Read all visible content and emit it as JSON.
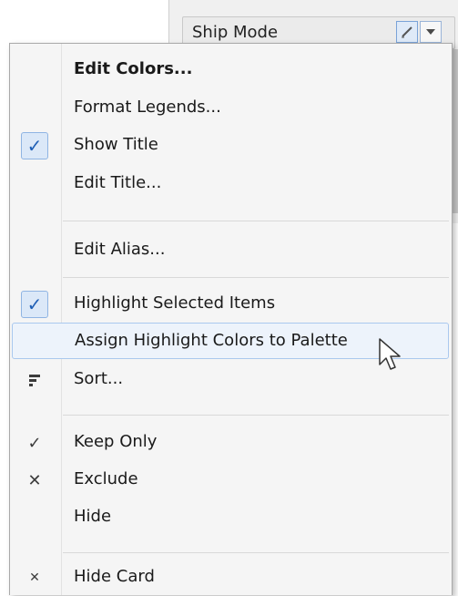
{
  "legend_card": {
    "title": "Ship Mode"
  },
  "menu": {
    "items": [
      {
        "label": "Edit Colors..."
      },
      {
        "label": "Format Legends..."
      },
      {
        "label": "Show Title"
      },
      {
        "label": "Edit Title..."
      },
      {
        "label": "Edit Alias..."
      },
      {
        "label": "Highlight Selected Items"
      },
      {
        "label": "Assign Highlight Colors to Palette"
      },
      {
        "label": "Sort..."
      },
      {
        "label": "Keep Only"
      },
      {
        "label": "Exclude"
      },
      {
        "label": "Hide"
      },
      {
        "label": "Hide Card"
      }
    ]
  },
  "icons": {
    "checked": "check-icon",
    "sort": "sort-icon",
    "keep_only": "check-mark-icon",
    "exclude": "x-icon",
    "hide_card": "small-x-icon",
    "pencil": "pencil-icon",
    "dropdown": "chevron-down-icon",
    "cursor": "mouse-cursor-icon"
  },
  "colors": {
    "accent": "#1f5fb6",
    "hover_bg": "#edf3fb",
    "menu_bg": "#f5f5f5"
  }
}
